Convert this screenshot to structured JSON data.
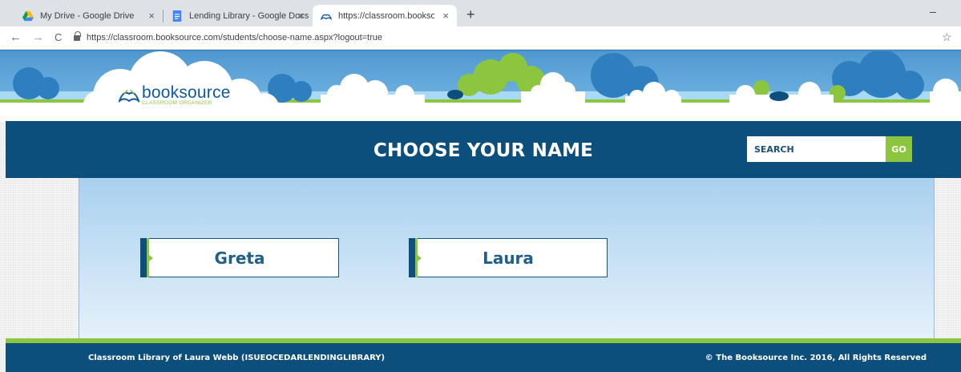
{
  "browser": {
    "tabs": [
      {
        "title": "My Drive - Google Drive",
        "icon": "google-drive-icon",
        "active": false
      },
      {
        "title": "Lending Library - Google Docs",
        "icon": "google-docs-icon",
        "active": false
      },
      {
        "title": "https://classroom.booksource.co",
        "icon": "booksource-icon",
        "active": true
      }
    ],
    "tab_close_glyph": "×",
    "new_tab_glyph": "+",
    "minimize_glyph": "–",
    "back_glyph": "←",
    "forward_glyph": "→",
    "reload_glyph": "C",
    "url": "https://classroom.booksource.com/students/choose-name.aspx?logout=true",
    "bookmark_glyph": "☆"
  },
  "logo": {
    "word": "booksource",
    "subtitle": "CLASSROOM ORGANIZER"
  },
  "header": {
    "title": "CHOOSE YOUR NAME",
    "search_placeholder": "SEARCH",
    "go_label": "GO"
  },
  "students": [
    {
      "name": "Greta"
    },
    {
      "name": "Laura"
    }
  ],
  "footer": {
    "left": "Classroom Library of Laura Webb (ISUEOCEDARLENDINGLIBRARY)",
    "right": "© The Booksource Inc. 2016, All Rights Reserved"
  },
  "colors": {
    "navy": "#0d4f7c",
    "green": "#8cc63f",
    "sky": "#6fb2e1"
  }
}
